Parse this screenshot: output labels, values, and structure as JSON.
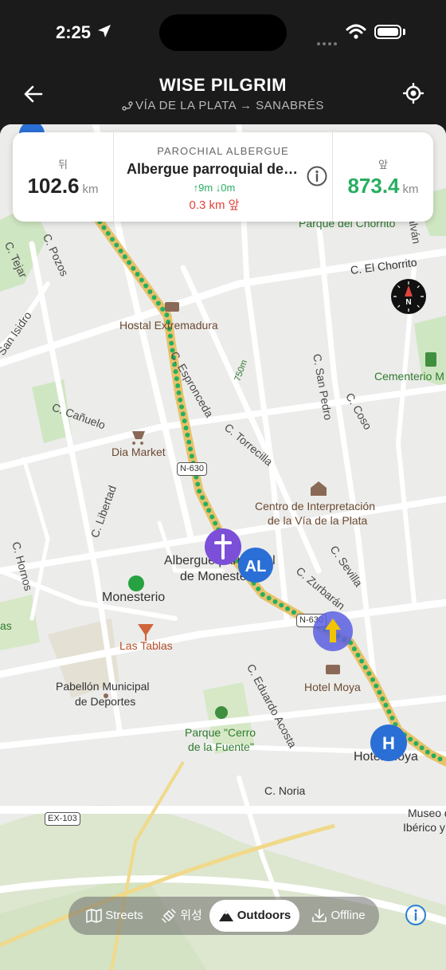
{
  "status_bar": {
    "time": "2:25"
  },
  "header": {
    "title": "WISE PILGRIM",
    "subtitle": "VÍA DE LA PLATA → SANABRÉS"
  },
  "info_card": {
    "behind_label": "뒤",
    "behind_distance": "102.6",
    "behind_unit": "km",
    "place_type": "PAROCHIAL ALBERGUE",
    "place_name": "Albergue parroquial de Monesterio",
    "elevation": "↑9m ↓0m",
    "distance_away": "0.3 km 앞",
    "ahead_label": "앞",
    "ahead_distance": "873.4",
    "ahead_unit": "km"
  },
  "map_labels": {
    "parque_chorrito": "Parque del Chorrito",
    "c_chorrito": "C. El Chorrito",
    "c_tejar": "C. Tejar",
    "c_pozos": "C. Pozos",
    "san_isidro": "San Isidro",
    "hostal_extremadura": "Hostal Extremadura",
    "c_espronceda": "C. Espronceda",
    "c_san_pedro": "C. San Pedro",
    "c_coso": "C. Coso",
    "cementerio": "Cementerio M",
    "c_canuelo": "C. Cañuelo",
    "dia_market": "Dia Market",
    "c_torrecilla": "C. Torrecilla",
    "c_libertad": "C. Libertad",
    "n630_a": "N-630",
    "centro_1": "Centro de Interpretación",
    "centro_2": "de la Vía de la Plata",
    "albergue_1": "Albergue parroquial",
    "albergue_2": "de Monesterio",
    "c_sevilla": "C. Sevilla",
    "c_hornos": "C. Hornos",
    "monesterio": "Monesterio",
    "c_zurbaran": "C. Zurbarán",
    "n630_b": "N-630",
    "las_tablas": "Las Tablas",
    "c_eduardo": "C. Eduardo Acosta",
    "hotel_moya_1": "Hotel Moya",
    "pabellon_1": "Pabellón Municipal",
    "pabellon_2": "de Deportes",
    "parque_cerro_1": "Parque \"Cerro",
    "parque_cerro_2": "de la Fuente\"",
    "hotel_moya_2": "Hotel Moya",
    "c_noria": "C. Noria",
    "ex103": "EX-103",
    "museo_1": "Museo d",
    "museo_2": "Ibérico y",
    "distance_marker": "750m",
    "c_galvan": "Galván",
    "as": "as"
  },
  "map_layers": {
    "streets": "Streets",
    "satellite": "위성",
    "outdoors": "Outdoors",
    "offline": "Offline",
    "active": "Outdoors"
  },
  "colors": {
    "route_dots": "#27ae60",
    "route_line": "#e8c26a",
    "accent_green": "#27ae60",
    "away_red": "#e0443a",
    "poi_purple": "#7b4fd8",
    "poi_blue": "#2a6fd6"
  }
}
